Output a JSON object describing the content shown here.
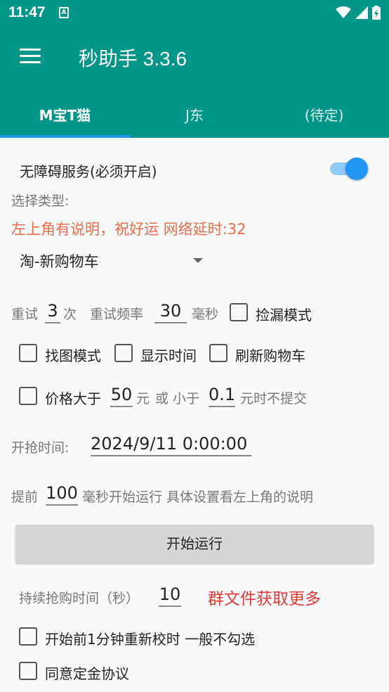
{
  "status_bar": {
    "time": "11:47",
    "notification_icon": "A"
  },
  "app_bar": {
    "title": "秒助手 3.3.6"
  },
  "tabs": [
    {
      "label": "M宝T猫",
      "active": true
    },
    {
      "label": "J东",
      "active": false
    },
    {
      "label": "(待定)",
      "active": false
    }
  ],
  "accessibility": {
    "label": "无障碍服务(必须开启)",
    "enabled": true
  },
  "select_type_label": "选择类型:",
  "notice": "左上角有说明，祝好运 网络延时:32",
  "type_dropdown": {
    "selected": "淘-新购物车"
  },
  "retry": {
    "label": "重试",
    "count": "3",
    "count_unit": "次",
    "freq_label": "重试频率",
    "freq": "30",
    "freq_unit": "毫秒"
  },
  "options": {
    "pickup_mode": "捡漏模式",
    "find_image_mode": "找图模式",
    "show_time": "显示时间",
    "refresh_cart": "刷新购物车"
  },
  "price": {
    "label": "价格大于",
    "min": "50",
    "unit1": "元",
    "or_text": "或 小于",
    "max": "0.1",
    "suffix": "元时不提交"
  },
  "start_time": {
    "label": "开抢时间:",
    "value": "2024/9/11 0:00:00"
  },
  "advance": {
    "prefix": "提前",
    "value": "100",
    "suffix": "毫秒开始运行 具体设置看左上角的说明"
  },
  "start_button": "开始运行",
  "duration": {
    "label": "持续抢购时间（秒）",
    "value": "10"
  },
  "group_text": "群文件获取更多",
  "recalibrate": "开始前1分钟重新校时 一般不勾选",
  "agree_deposit": "同意定金协议",
  "colors": {
    "primary": "#009688",
    "accent": "#2196f3",
    "warning": "#f26a4b",
    "highlight": "#e53935"
  }
}
